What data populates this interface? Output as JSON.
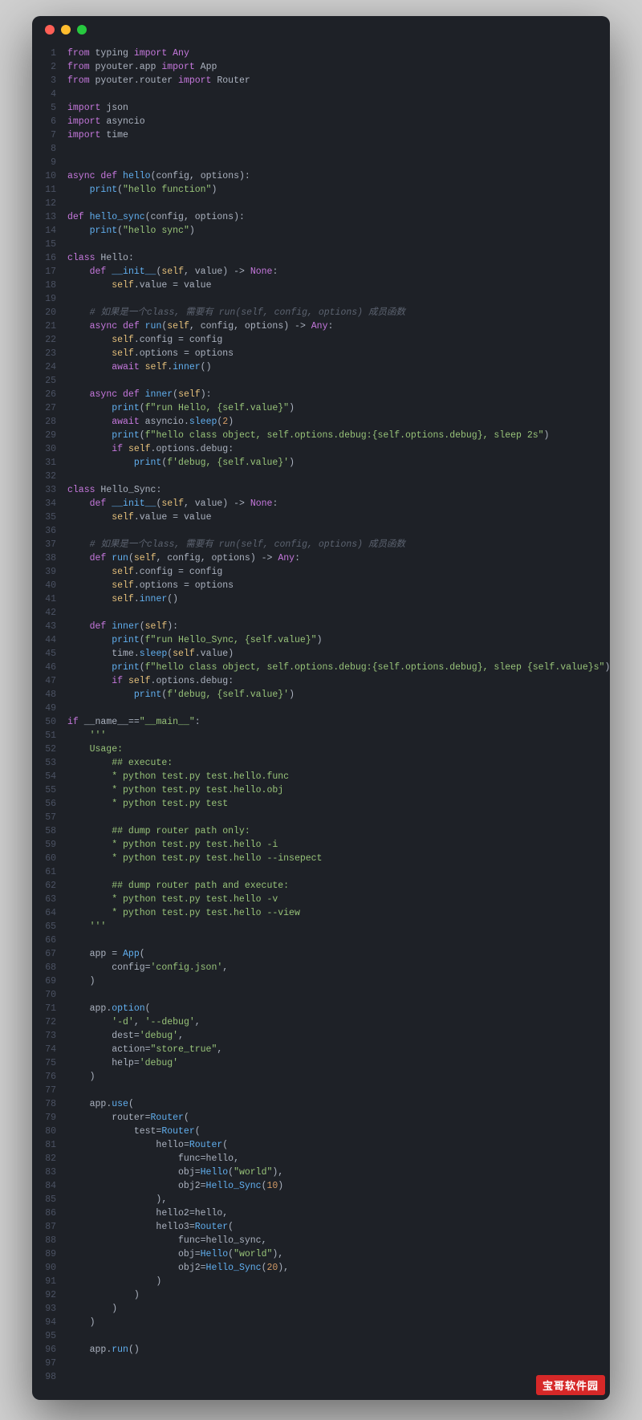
{
  "watermark": "宝哥软件园",
  "lineCount": 98,
  "code": {
    "plain": [
      "from typing import Any",
      "from pyouter.app import App",
      "from pyouter.router import Router",
      "",
      "import json",
      "import asyncio",
      "import time",
      "",
      "",
      "async def hello(config, options):",
      "    print(\"hello function\")",
      "",
      "def hello_sync(config, options):",
      "    print(\"hello sync\")",
      "",
      "class Hello:",
      "    def __init__(self, value) -> None:",
      "        self.value = value",
      "",
      "    # 如果是一个class, 需要有 run(self, config, options) 成员函数",
      "    async def run(self, config, options) -> Any:",
      "        self.config = config",
      "        self.options = options",
      "        await self.inner()",
      "",
      "    async def inner(self):",
      "        print(f\"run Hello, {self.value}\")",
      "        await asyncio.sleep(2)",
      "        print(f\"hello class object, self.options.debug:{self.options.debug}, sleep 2s\")",
      "        if self.options.debug:",
      "            print(f'debug, {self.value}')",
      "",
      "class Hello_Sync:",
      "    def __init__(self, value) -> None:",
      "        self.value = value",
      "",
      "    # 如果是一个class, 需要有 run(self, config, options) 成员函数",
      "    def run(self, config, options) -> Any:",
      "        self.config = config",
      "        self.options = options",
      "        self.inner()",
      "",
      "    def inner(self):",
      "        print(f\"run Hello_Sync, {self.value}\")",
      "        time.sleep(self.value)",
      "        print(f\"hello class object, self.options.debug:{self.options.debug}, sleep {self.value}s\")",
      "        if self.options.debug:",
      "            print(f'debug, {self.value}')",
      "",
      "if __name__==\"__main__\":",
      "    '''",
      "    Usage:",
      "        ## execute:",
      "        * python test.py test.hello.func",
      "        * python test.py test.hello.obj",
      "        * python test.py test",
      "",
      "        ## dump router path only:",
      "        * python test.py test.hello -i",
      "        * python test.py test.hello --insepect",
      "",
      "        ## dump router path and execute:",
      "        * python test.py test.hello -v",
      "        * python test.py test.hello --view",
      "    '''",
      "",
      "    app = App(",
      "        config='config.json',",
      "    )",
      "",
      "    app.option(",
      "        '-d', '--debug',",
      "        dest='debug',",
      "        action=\"store_true\",",
      "        help='debug'",
      "    )",
      "",
      "    app.use(",
      "        router=Router(",
      "            test=Router(",
      "                hello=Router(",
      "                    func=hello,",
      "                    obj=Hello(\"world\"),",
      "                    obj2=Hello_Sync(10)",
      "                ),",
      "                hello2=hello,",
      "                hello3=Router(",
      "                    func=hello_sync,",
      "                    obj=Hello(\"world\"),",
      "                    obj2=Hello_Sync(20),",
      "                )",
      "            )",
      "        )",
      "    )",
      "",
      "    app.run()",
      "",
      ""
    ]
  }
}
